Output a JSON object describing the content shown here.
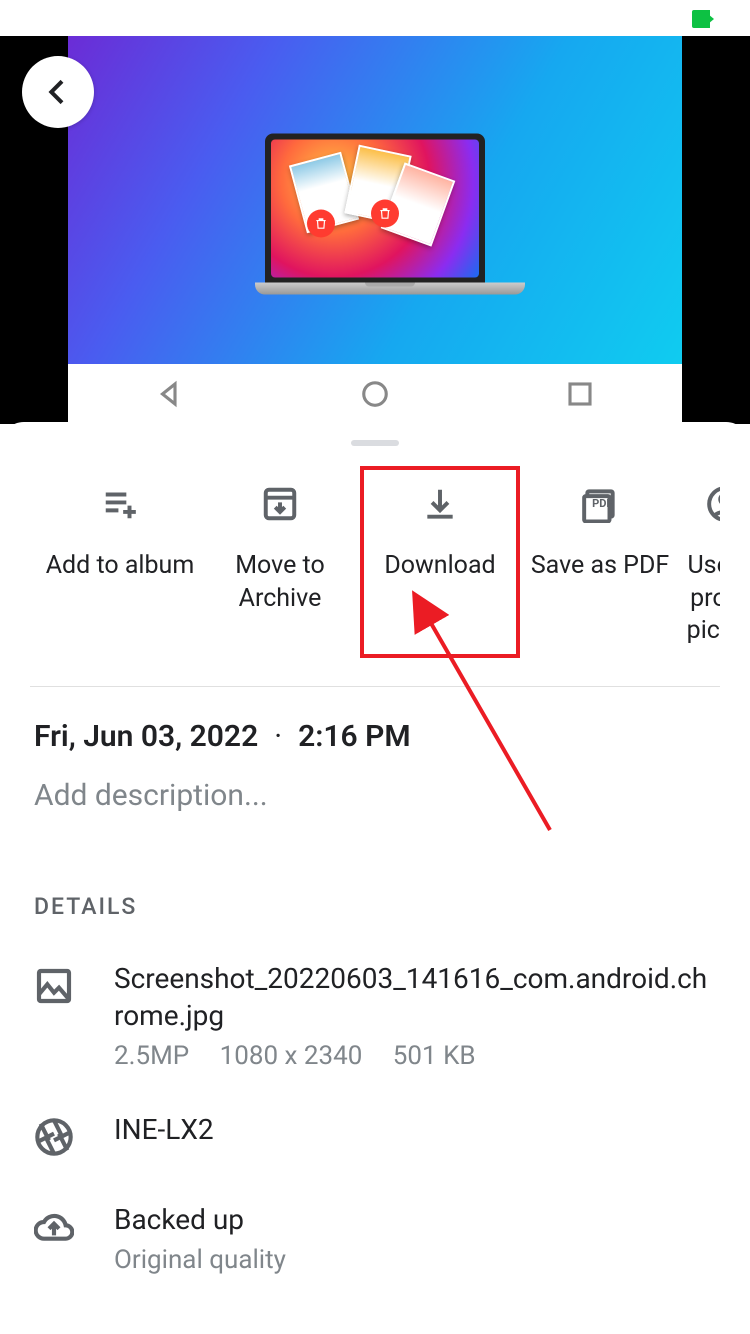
{
  "actions": {
    "add_to_album": "Add to album",
    "move_to_archive": "Move to Archive",
    "download": "Download",
    "save_as_pdf": "Save as PDF",
    "use_as_profile": "Use as profile picture"
  },
  "datetime": {
    "date": "Fri, Jun 03, 2022",
    "separator": "·",
    "time": "2:16 PM"
  },
  "description_placeholder": "Add description...",
  "details": {
    "heading": "DETAILS",
    "filename": "Screenshot_20220603_141616_com.android.chrome.jpg",
    "megapixels": "2.5MP",
    "resolution": "1080 x 2340",
    "filesize": "501 KB",
    "device": "INE-LX2",
    "backup_status": "Backed up",
    "backup_quality": "Original quality"
  }
}
